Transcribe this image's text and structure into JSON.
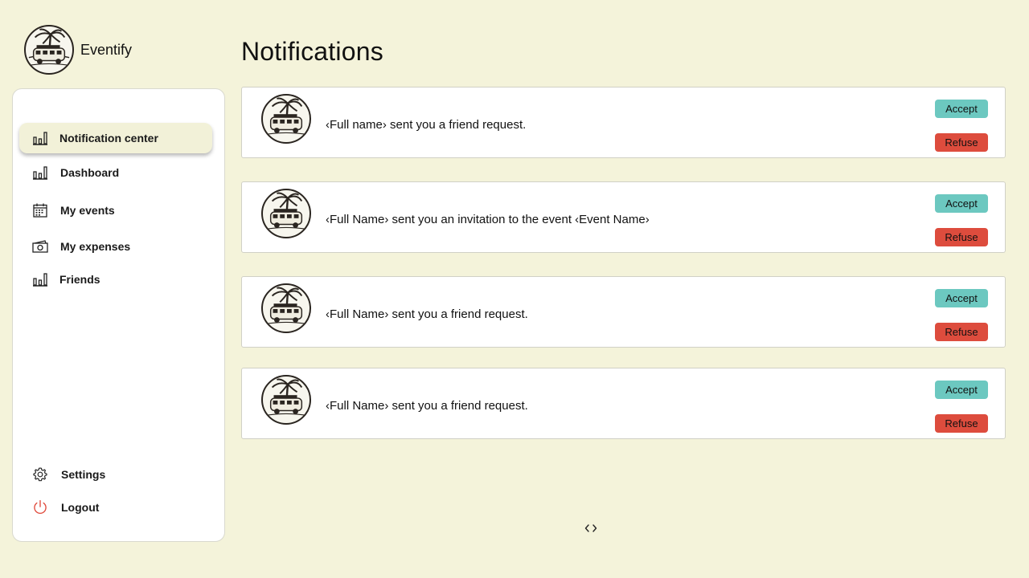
{
  "app": {
    "name": "Eventify",
    "logo_icon": "palm-van-logo"
  },
  "sidebar": {
    "items": [
      {
        "label": "Notification center",
        "icon": "bar-chart-icon",
        "active": true
      },
      {
        "label": "Dashboard",
        "icon": "bar-chart-icon",
        "active": false
      },
      {
        "label": "My events",
        "icon": "calendar-icon",
        "active": false
      },
      {
        "label": "My expenses",
        "icon": "cash-icon",
        "active": false
      },
      {
        "label": "Friends",
        "icon": "bar-chart-icon",
        "active": false
      }
    ],
    "bottom_items": [
      {
        "label": "Settings",
        "icon": "gear-icon"
      },
      {
        "label": "Logout",
        "icon": "power-icon",
        "color": "#e0483a"
      }
    ]
  },
  "main": {
    "title": "Notifications",
    "notifications": [
      {
        "text": "‹Full name› sent you a friend request.",
        "accept_label": "Accept",
        "refuse_label": "Refuse"
      },
      {
        "text": "‹Full Name› sent you an invitation to the event ‹Event Name›",
        "accept_label": "Accept",
        "refuse_label": "Refuse"
      },
      {
        "text": "‹Full Name› sent you a friend request.",
        "accept_label": "Accept",
        "refuse_label": "Refuse"
      },
      {
        "text": "‹Full Name› sent you a friend request.",
        "accept_label": "Accept",
        "refuse_label": "Refuse"
      }
    ],
    "pager_icon": "code-brackets-icon"
  },
  "colors": {
    "background": "#f4f3da",
    "accept": "#6cc8c0",
    "refuse": "#dd4c3d",
    "active_nav": "#f2f1d8"
  }
}
